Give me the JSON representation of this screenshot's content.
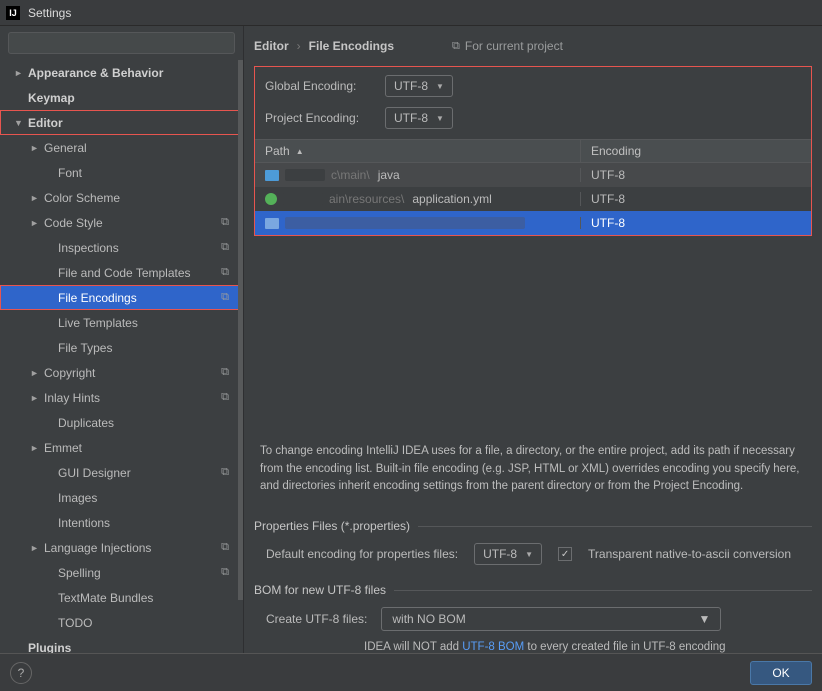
{
  "window": {
    "title": "Settings"
  },
  "search": {
    "placeholder": ""
  },
  "sidebar": {
    "items": [
      {
        "label": "Appearance & Behavior",
        "arrow": "►",
        "bold": true
      },
      {
        "label": "Keymap",
        "arrow": "",
        "bold": true
      },
      {
        "label": "Editor",
        "arrow": "▼",
        "bold": true,
        "hl": true
      },
      {
        "label": "General",
        "arrow": "►",
        "lvl": 1
      },
      {
        "label": "Font",
        "lvl": 2
      },
      {
        "label": "Color Scheme",
        "arrow": "►",
        "lvl": 1
      },
      {
        "label": "Code Style",
        "arrow": "►",
        "lvl": 1,
        "proj": true
      },
      {
        "label": "Inspections",
        "lvl": 2,
        "proj": true
      },
      {
        "label": "File and Code Templates",
        "lvl": 2,
        "proj": true
      },
      {
        "label": "File Encodings",
        "lvl": 2,
        "proj": true,
        "selected": true,
        "hl": true
      },
      {
        "label": "Live Templates",
        "lvl": 2
      },
      {
        "label": "File Types",
        "lvl": 2
      },
      {
        "label": "Copyright",
        "arrow": "►",
        "lvl": 1,
        "proj": true
      },
      {
        "label": "Inlay Hints",
        "arrow": "►",
        "lvl": 1,
        "proj": true
      },
      {
        "label": "Duplicates",
        "lvl": 2
      },
      {
        "label": "Emmet",
        "arrow": "►",
        "lvl": 1
      },
      {
        "label": "GUI Designer",
        "lvl": 2,
        "proj": true
      },
      {
        "label": "Images",
        "lvl": 2
      },
      {
        "label": "Intentions",
        "lvl": 2
      },
      {
        "label": "Language Injections",
        "arrow": "►",
        "lvl": 1,
        "proj": true
      },
      {
        "label": "Spelling",
        "lvl": 2,
        "proj": true
      },
      {
        "label": "TextMate Bundles",
        "lvl": 2
      },
      {
        "label": "TODO",
        "lvl": 2
      },
      {
        "label": "Plugins",
        "arrow": "",
        "bold": true
      }
    ]
  },
  "breadcrumb": {
    "root": "Editor",
    "sep": "›",
    "page": "File Encodings",
    "indicator": "For current project"
  },
  "encodings": {
    "global_label": "Global Encoding:",
    "global_value": "UTF-8",
    "project_label": "Project Encoding:",
    "project_value": "UTF-8",
    "columns": {
      "path": "Path",
      "encoding": "Encoding"
    },
    "rows": [
      {
        "icon": "folder",
        "path_prefix": "c\\main\\",
        "path_tail": "java",
        "encoding": "UTF-8"
      },
      {
        "icon": "file",
        "path_prefix": "ain\\resources\\",
        "path_tail": "application.yml",
        "encoding": "UTF-8"
      },
      {
        "icon": "folder-sel",
        "path_prefix": "",
        "path_tail": "",
        "encoding": "UTF-8",
        "selected": true
      }
    ]
  },
  "helptext": "To change encoding IntelliJ IDEA uses for a file, a directory, or the entire project, add its path if necessary from the encoding list. Built-in file encoding (e.g. JSP, HTML or XML) overrides encoding you specify here, and directories inherit encoding settings from the parent directory or from the Project Encoding.",
  "properties": {
    "section": "Properties Files (*.properties)",
    "default_label": "Default encoding for properties files:",
    "default_value": "UTF-8",
    "transparent_label": "Transparent native-to-ascii conversion",
    "transparent_checked": true
  },
  "bom": {
    "section": "BOM for new UTF-8 files",
    "create_label": "Create UTF-8 files:",
    "create_value": "with NO BOM",
    "note_pre": "IDEA will NOT add ",
    "note_link": "UTF-8 BOM",
    "note_post": " to every created file in UTF-8 encoding"
  },
  "footer": {
    "ok": "OK"
  }
}
